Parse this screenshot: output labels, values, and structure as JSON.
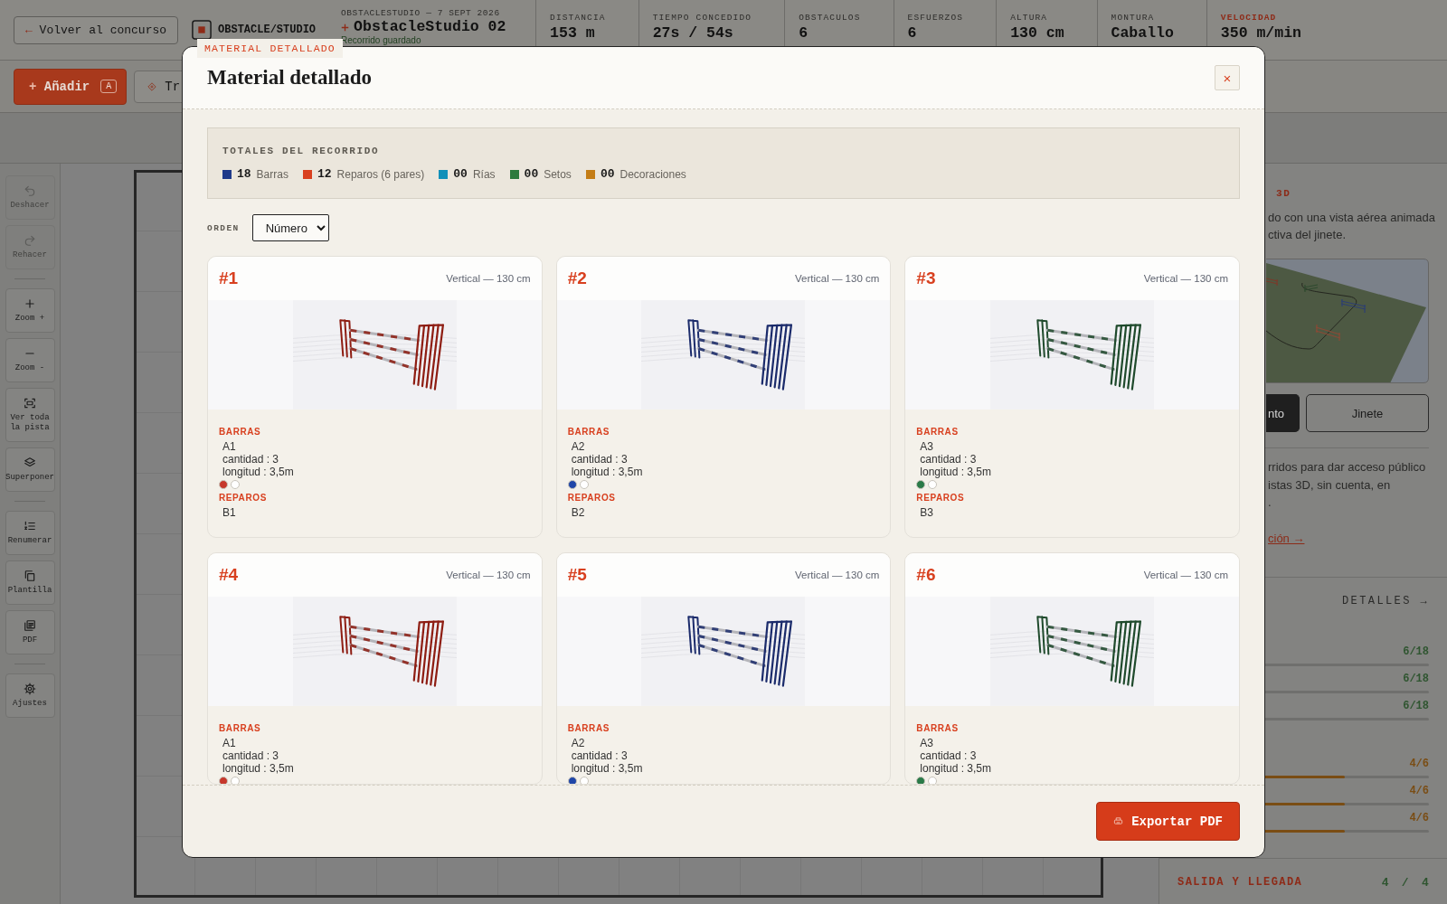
{
  "header": {
    "back_button": {
      "arrow": "←",
      "label": "Volver al concurso"
    },
    "brand": "OBSTACLE/STUDIO",
    "course": {
      "meta": "OBSTACLESTUDIO — 7 SEPT 2026",
      "title": "ObstacleStudio 02",
      "status": "Recorrido guardado"
    },
    "stats": [
      {
        "label": "DISTANCIA",
        "value": "153 m",
        "highlight": false
      },
      {
        "label": "TIEMPO CONCEDIDO",
        "value": "27s / 54s",
        "highlight": false
      },
      {
        "label": "OBSTACULOS",
        "value": "6",
        "highlight": false
      },
      {
        "label": "ESFUERZOS",
        "value": "6",
        "highlight": false
      },
      {
        "label": "ALTURA",
        "value": "130 cm",
        "highlight": false
      },
      {
        "label": "MONTURA",
        "value": "Caballo",
        "highlight": false
      },
      {
        "label": "VELOCIDAD",
        "value": "350 m/min",
        "highlight": true
      }
    ]
  },
  "toolbar": {
    "buttons": [
      {
        "kind": "primary",
        "symbol": "+",
        "label": "Añadir",
        "shortcut": "A"
      },
      {
        "kind": "secondary",
        "label": "Tr"
      }
    ]
  },
  "tool_groups": [
    {
      "items": [
        {
          "label": "Deshacer",
          "disabled": true
        },
        {
          "label": "Rehacer",
          "disabled": true
        }
      ]
    },
    {
      "items": [
        {
          "label": "Zoom +",
          "disabled": false
        },
        {
          "label": "Zoom -",
          "disabled": false
        },
        {
          "label": "Ver toda la pista",
          "disabled": false
        },
        {
          "label": "Superponer",
          "disabled": false
        }
      ]
    },
    {
      "items": [
        {
          "label": "Renumerar",
          "disabled": false
        },
        {
          "label": "Plantilla",
          "disabled": false
        },
        {
          "label": "PDF",
          "disabled": false
        }
      ]
    },
    {
      "items": [
        {
          "label": "Ajustes",
          "disabled": false
        }
      ]
    }
  ],
  "right_panel": {
    "title": "3D",
    "intro": [
      "do con una vista aérea animada",
      "ctiva del jinete."
    ],
    "view_buttons": [
      {
        "label": "nto",
        "selected": true
      },
      {
        "label": "Jinete",
        "selected": false
      }
    ],
    "share_text": [
      "rridos para dar acceso público",
      "istas 3D, sin cuenta, en",
      "."
    ],
    "share_link": "ción →",
    "details_link": "DETALLES →",
    "meter_groups": [
      {
        "color": "#2f5530",
        "rows": [
          {
            "value": "6/18"
          },
          {
            "value": "6/18"
          },
          {
            "value": "6/18"
          }
        ]
      },
      {
        "color": "#7a4d14",
        "rows": [
          {
            "value": "4/6",
            "level": 0.667
          },
          {
            "value": "4/6",
            "level": 0.667
          },
          {
            "value": "4/6",
            "level": 0.667
          }
        ]
      }
    ],
    "start_finish": {
      "label": "SALIDA Y LLEGADA",
      "value": "4 / 4"
    }
  },
  "modal": {
    "tag": "MATERIAL DETALLADO",
    "title": "Material detallado",
    "close": "×",
    "totals": {
      "title": "TOTALES DEL RECORRIDO",
      "items": [
        {
          "count": "18",
          "label": "Barras",
          "color": "#1f3a8a"
        },
        {
          "count": "12",
          "label": "Reparos (6 pares)",
          "color": "#d9401f"
        },
        {
          "count": "00",
          "label": "Rías",
          "color": "#1190b9"
        },
        {
          "count": "00",
          "label": "Setos",
          "color": "#2c7a3c"
        },
        {
          "count": "00",
          "label": "Decoraciones",
          "color": "#c47d16"
        }
      ]
    },
    "sort": {
      "label": "ORDEN",
      "value": "Número"
    },
    "cards": [
      {
        "number": "#1",
        "type": "Vertical — 130 cm",
        "color": "#8e1d12",
        "sections": [
          {
            "title": "BARRAS",
            "lines": [
              "A1",
              "cantidad : 3",
              "longitud : 3,5m"
            ],
            "dots": [
              {
                "color": "#c6372b"
              },
              {
                "color": "#ffffff"
              }
            ]
          },
          {
            "title": "REPAROS",
            "lines": [
              "B1"
            ]
          }
        ]
      },
      {
        "number": "#2",
        "type": "Vertical — 130 cm",
        "color": "#1b2b6b",
        "sections": [
          {
            "title": "BARRAS",
            "lines": [
              "A2",
              "cantidad : 3",
              "longitud : 3,5m"
            ],
            "dots": [
              {
                "color": "#1f46a8"
              },
              {
                "color": "#ffffff"
              }
            ]
          },
          {
            "title": "REPAROS",
            "lines": [
              "B2"
            ]
          }
        ]
      },
      {
        "number": "#3",
        "type": "Vertical — 130 cm",
        "color": "#1f4a2c",
        "sections": [
          {
            "title": "BARRAS",
            "lines": [
              "A3",
              "cantidad : 3",
              "longitud : 3,5m"
            ],
            "dots": [
              {
                "color": "#2a7a48"
              },
              {
                "color": "#ffffff"
              }
            ]
          },
          {
            "title": "REPAROS",
            "lines": [
              "B3"
            ]
          }
        ]
      },
      {
        "number": "#4",
        "type": "Vertical — 130 cm",
        "color": "#8e1d12",
        "sections": [
          {
            "title": "BARRAS",
            "lines": [
              "A1",
              "cantidad : 3",
              "longitud : 3,5m"
            ],
            "dots": [
              {
                "color": "#c6372b"
              },
              {
                "color": "#ffffff"
              }
            ]
          }
        ]
      },
      {
        "number": "#5",
        "type": "Vertical — 130 cm",
        "color": "#1b2b6b",
        "sections": [
          {
            "title": "BARRAS",
            "lines": [
              "A2",
              "cantidad : 3",
              "longitud : 3,5m"
            ],
            "dots": [
              {
                "color": "#1f46a8"
              },
              {
                "color": "#ffffff"
              }
            ]
          }
        ]
      },
      {
        "number": "#6",
        "type": "Vertical — 130 cm",
        "color": "#1f4a2c",
        "sections": [
          {
            "title": "BARRAS",
            "lines": [
              "A3",
              "cantidad : 3",
              "longitud : 3,5m"
            ],
            "dots": [
              {
                "color": "#2a7a48"
              },
              {
                "color": "#ffffff"
              }
            ]
          }
        ]
      }
    ],
    "export_button": "Exportar PDF"
  }
}
